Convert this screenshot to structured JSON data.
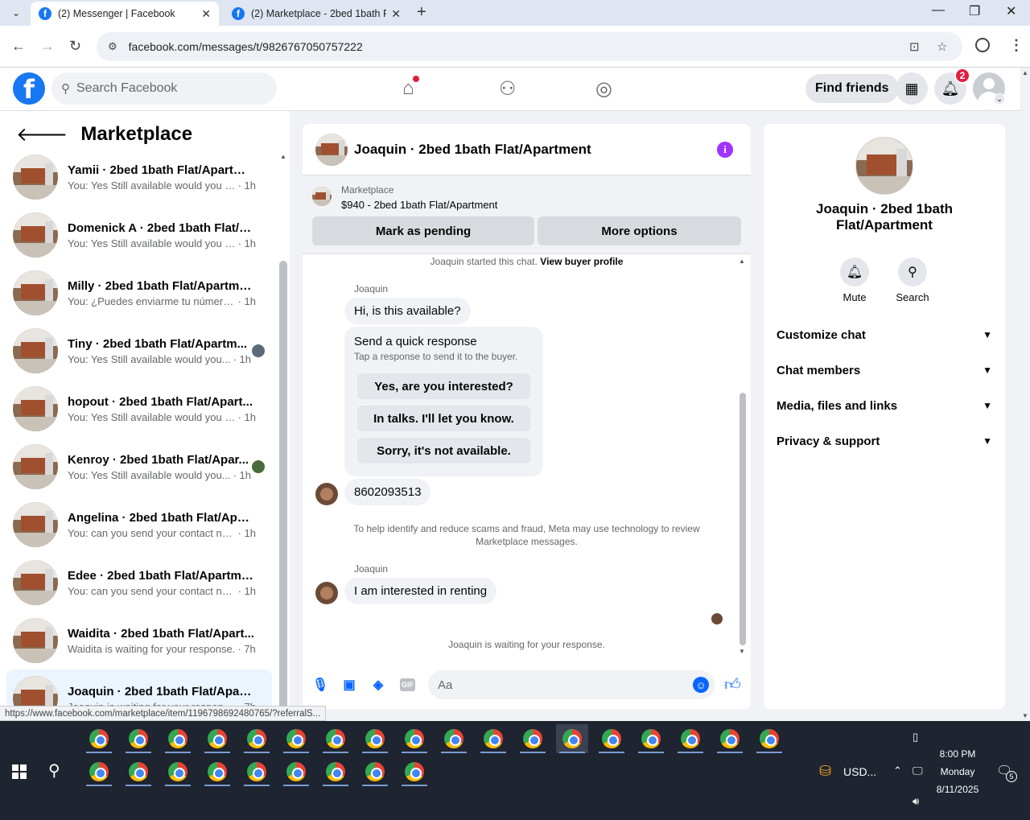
{
  "browser": {
    "tabs": [
      {
        "title": "(2) Messenger | Facebook",
        "active": true
      },
      {
        "title": "(2) Marketplace - 2bed 1bath Flat/Apartment",
        "active": false
      }
    ],
    "url": "facebook.com/messages/t/9826767050757222",
    "status_url": "https://www.facebook.com/marketplace/item/1196798692480765/?referralS..."
  },
  "fb_header": {
    "search_placeholder": "Search Facebook",
    "find_friends": "Find friends",
    "notifications_count": "2"
  },
  "left_panel": {
    "title": "Marketplace",
    "conversations": [
      {
        "name": "Yamii · 2bed 1bath Flat/Apartment",
        "preview": "You: Yes Still available would you lik...",
        "time": "· 1h"
      },
      {
        "name": "Domenick A · 2bed 1bath Flat/A...",
        "preview": "You: Yes Still available would you lik...",
        "time": "· 1h"
      },
      {
        "name": "Milly · 2bed 1bath Flat/Apartment",
        "preview": "You: ¿Puedes enviarme tu número ...",
        "time": "· 1h"
      },
      {
        "name": "Tiny · 2bed 1bath Flat/Apartm...",
        "preview": "You: Yes Still available would you...",
        "time": "· 1h"
      },
      {
        "name": "hopout · 2bed 1bath Flat/Apart...",
        "preview": "You: Yes Still available would you lik...",
        "time": "· 1h"
      },
      {
        "name": "Kenroy · 2bed 1bath Flat/Apar...",
        "preview": "You: Yes Still available would you...",
        "time": "· 1h"
      },
      {
        "name": "Angelina · 2bed 1bath Flat/Apart...",
        "preview": "You: can you send your contact nu...",
        "time": "· 1h"
      },
      {
        "name": "Edee · 2bed 1bath Flat/Apartment",
        "preview": "You: can you send your contact nu...",
        "time": "· 1h"
      },
      {
        "name": "Waidita · 2bed 1bath Flat/Apart...",
        "preview": "Waidita is waiting for your response.",
        "time": "· 7h"
      },
      {
        "name": "Joaquin · 2bed 1bath Flat/Apart...",
        "preview": "Joaquin is waiting for your response.",
        "time": "· 7h"
      }
    ]
  },
  "chat": {
    "title": "Joaquin · 2bed 1bath Flat/Apartment",
    "marketplace_label": "Marketplace",
    "listing": "$940 - 2bed 1bath Flat/Apartment",
    "mark_pending": "Mark as pending",
    "more_options": "More options",
    "started_text": "Joaquin started this chat.",
    "view_profile": "View buyer profile",
    "sender1": "Joaquin",
    "msg1": "Hi, is this available?",
    "quick_title": "Send a quick response",
    "quick_sub": "Tap a response to send it to the buyer.",
    "quick_replies": [
      "Yes, are you interested?",
      "In talks. I'll let you know.",
      "Sorry, it's not available."
    ],
    "msg2": "8602093513",
    "notice": "To help identify and reduce scams and fraud, Meta may use technology to review Marketplace messages.",
    "sender2": "Joaquin",
    "msg3": "I am interested in renting",
    "waiting": "Joaquin is waiting for your response.",
    "input_placeholder": "Aa",
    "gif_label": "GIF"
  },
  "right_panel": {
    "name": "Joaquin · 2bed 1bath Flat/Apartment",
    "mute": "Mute",
    "search": "Search",
    "sections": [
      "Customize chat",
      "Chat members",
      "Media, files and links",
      "Privacy & support"
    ]
  },
  "taskbar": {
    "currency": "USD...",
    "time": "8:00 PM",
    "day": "Monday",
    "date": "8/11/2025",
    "notifications": "5"
  }
}
